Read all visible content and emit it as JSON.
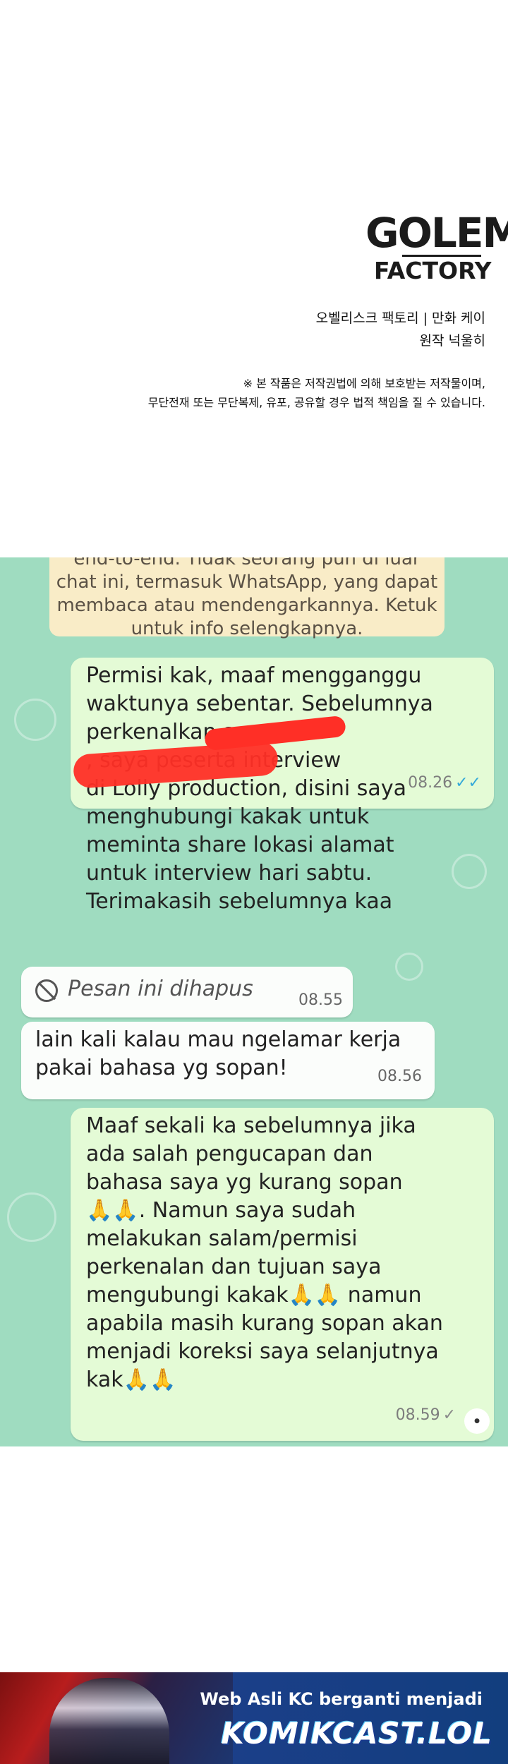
{
  "credits": {
    "logo_line1": "GOLEM",
    "logo_line2": "FACTORY",
    "line1": "오벨리스크 팩토리  | 만화 케이",
    "line2": "원작 넉울히",
    "notice_line1": "※ 본 작품은 저작권법에 의해 보호받는 저작물이며,",
    "notice_line2": "무단전재 또는 무단복제, 유포, 공유할 경우 법적 책임을 질 수 있습니다."
  },
  "chat": {
    "encryption_notice": "end-to-end. Tidak seorang pun di luar\nchat ini, termasuk WhatsApp, yang dapat\nmembaca atau mendengarkannya. Ketuk\nuntuk info selengkapnya.",
    "messages": [
      {
        "text": "Permisi kak, maaf mengganggu\nwaktunya sebentar. Sebelumnya\nperkenalkan saya\n                    , saya peserta interview\ndi Lolly production, disini saya\nmenghubungi kakak untuk\nmeminta share lokasi alamat\nuntuk interview hari sabtu.\nTerimakasih sebelumnya kaa",
        "time": "08.26",
        "ticks": "✓✓"
      },
      {
        "text": "Pesan ini dihapus",
        "time": "08.55"
      },
      {
        "text": "lain kali kalau mau ngelamar kerja\npakai bahasa yg sopan!",
        "time": "08.56"
      },
      {
        "text": "Maaf sekali ka sebelumnya jika\nada salah pengucapan dan\nbahasa saya yg kurang sopan\n🙏🙏. Namun saya sudah\nmelakukan salam/permisi\nperkenalan dan tujuan saya\nmengubungi kakak🙏🙏 namun\napabila masih kurang sopan akan\nmenjadi koreksi saya selanjutnya\nkak🙏🙏",
        "time": "08.59",
        "ticks": "✓"
      }
    ]
  },
  "banner": {
    "line1": "Web Asli KC berganti menjadi",
    "line2": "KOMIKCAST.LOL"
  }
}
